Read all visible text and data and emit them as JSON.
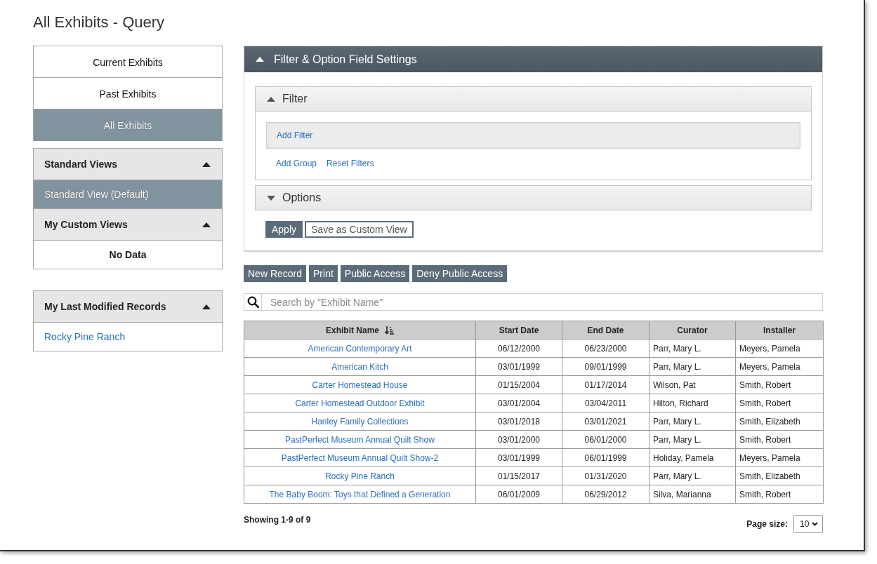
{
  "page": {
    "title": "All Exhibits - Query"
  },
  "sidebar": {
    "exhibit_tabs": [
      {
        "label": "Current Exhibits",
        "selected": false
      },
      {
        "label": "Past Exhibits",
        "selected": false
      },
      {
        "label": "All Exhibits",
        "selected": true
      }
    ],
    "standard_views": {
      "title": "Standard Views",
      "expanded": true,
      "items": [
        {
          "label": "Standard View (Default)",
          "selected": true
        }
      ]
    },
    "custom_views": {
      "title": "My Custom Views",
      "expanded": true,
      "empty_text": "No Data"
    },
    "last_modified": {
      "title": "My Last Modified Records",
      "expanded": true,
      "items": [
        "Rocky Pine Ranch"
      ]
    }
  },
  "settings_panel": {
    "title": "Filter & Option Field Settings",
    "expanded": true,
    "filter": {
      "title": "Filter",
      "expanded": true,
      "add_filter": "Add Filter",
      "links": [
        "Add Group",
        "Reset Filters"
      ]
    },
    "options": {
      "title": "Options",
      "expanded": false
    },
    "buttons": [
      {
        "label": "Apply",
        "kind": "primary"
      },
      {
        "label": "Save as Custom View",
        "kind": "outline"
      }
    ]
  },
  "toolbar": [
    "New Record",
    "Print",
    "Public Access",
    "Deny Public Access"
  ],
  "search": {
    "placeholder": "Search by \"Exhibit Name\""
  },
  "table": {
    "columns": [
      {
        "label": "Exhibit Name",
        "sorted": true
      },
      {
        "label": "Start Date",
        "sorted": false
      },
      {
        "label": "End Date",
        "sorted": false
      },
      {
        "label": "Curator",
        "sorted": false
      },
      {
        "label": "Installer",
        "sorted": false
      }
    ],
    "rows": [
      [
        "American Contemporary Art",
        "06/12/2000",
        "06/23/2000",
        "Parr, Mary L.",
        "Meyers, Pamela"
      ],
      [
        "American Kitch",
        "03/01/1999",
        "09/01/1999",
        "Parr, Mary L.",
        "Meyers, Pamela"
      ],
      [
        "Carter Homestead House",
        "01/15/2004",
        "01/17/2014",
        "Wilson, Pat",
        "Smith, Robert"
      ],
      [
        "Carter Homestead Outdoor Exhibit",
        "03/01/2004",
        "03/04/2011",
        "Hilton, Richard",
        "Smith, Robert"
      ],
      [
        "Hanley Family Collections",
        "03/01/2018",
        "03/01/2021",
        "Parr, Mary L.",
        "Smith, Elizabeth"
      ],
      [
        "PastPerfect Museum Annual Quilt Show",
        "03/01/2000",
        "06/01/2000",
        "Parr, Mary L.",
        "Smith, Robert"
      ],
      [
        "PastPerfect Museum Annual Quilt Show-2",
        "03/01/1999",
        "06/01/1999",
        "Holiday, Pamela",
        "Meyers, Pamela"
      ],
      [
        "Rocky Pine Ranch",
        "01/15/2017",
        "01/31/2020",
        "Parr, Mary L.",
        "Smith, Elizabeth"
      ],
      [
        "The Baby Boom: Toys that Defined a Generation",
        "06/01/2009",
        "06/29/2012",
        "Silva, Marianna",
        "Smith, Robert"
      ]
    ]
  },
  "pager": {
    "summary": "Showing 1-9 of 9",
    "page_size_label": "Page size:",
    "page_size": "10"
  }
}
